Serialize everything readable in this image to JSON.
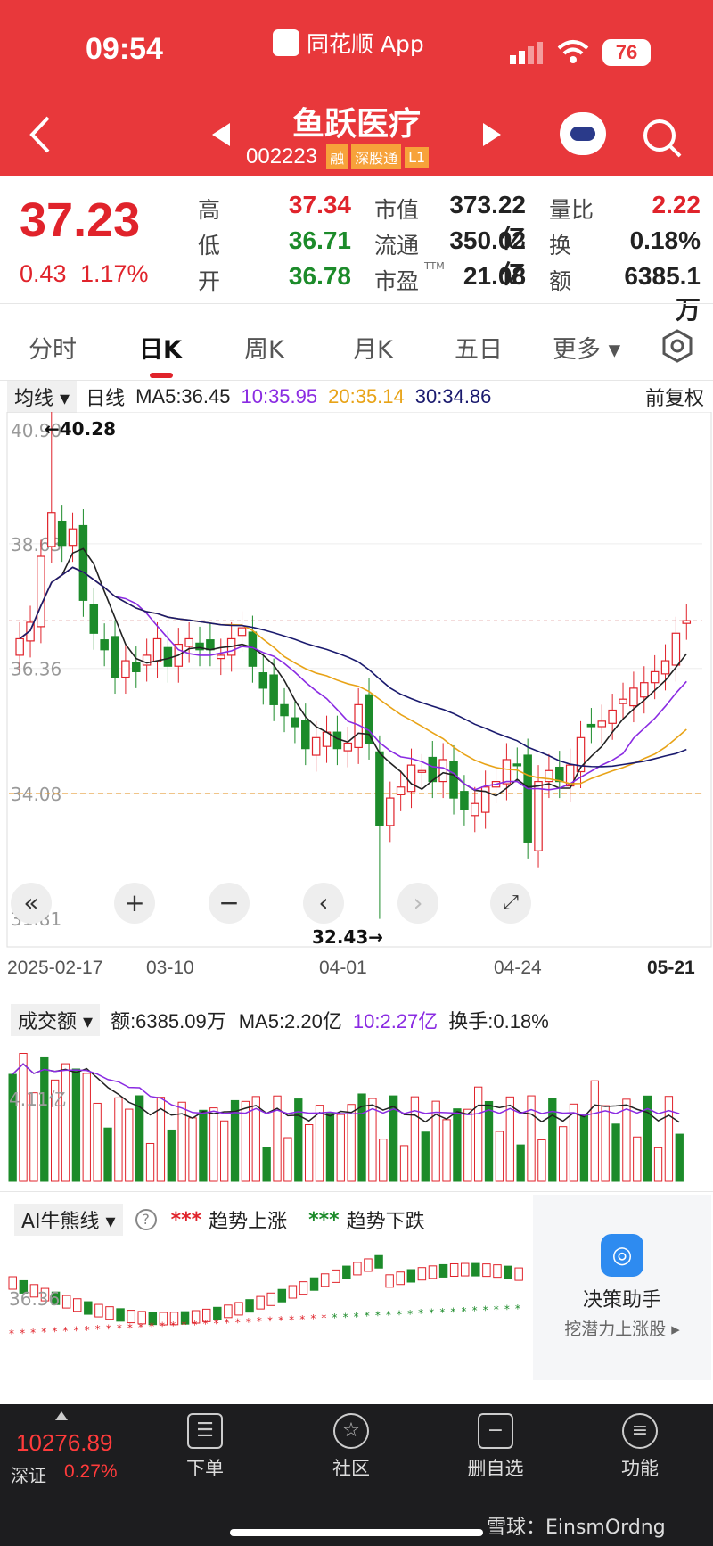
{
  "status_bar": {
    "time": "09:54",
    "app": "同花顺 App",
    "battery": "76"
  },
  "header": {
    "stock_name": "鱼跃医疗",
    "code": "002223",
    "badges": [
      "融",
      "深股通",
      "L1"
    ]
  },
  "quote": {
    "price": "37.23",
    "change": "0.43",
    "change_pct": "1.17%",
    "stats": [
      {
        "label": "高",
        "value": "37.34",
        "color": "red"
      },
      {
        "label": "市值",
        "value": "373.22亿",
        "color": "dark"
      },
      {
        "label": "量比",
        "value": "2.22",
        "color": "red"
      },
      {
        "label": "低",
        "value": "36.71",
        "color": "green"
      },
      {
        "label": "流通",
        "value": "350.02亿",
        "color": "dark"
      },
      {
        "label": "换",
        "value": "0.18%",
        "color": "dark"
      },
      {
        "label": "开",
        "value": "36.78",
        "color": "green"
      },
      {
        "label": "市盈",
        "value": "21.08",
        "color": "dark",
        "sup": "TTM"
      },
      {
        "label": "额",
        "value": "6385.1万",
        "color": "dark"
      }
    ]
  },
  "tabs": [
    "分时",
    "日K",
    "周K",
    "月K",
    "五日",
    "更多"
  ],
  "ma_bar": {
    "selector": "均线",
    "period": "日线",
    "ma5": "MA5:36.45",
    "ma10": "10:35.95",
    "ma20": "20:35.14",
    "ma30": "30:34.86",
    "adjust": "前复权"
  },
  "kline": {
    "y_labels": [
      "40.90",
      "38.63",
      "36.36",
      "34.08",
      "31.81"
    ],
    "max_label": "40.28",
    "min_label": "32.43",
    "dates": [
      "2025-02-17",
      "03-10",
      "04-01",
      "04-24",
      "05-21"
    ],
    "ref_price": 34.08,
    "current_price": 37.23
  },
  "volume": {
    "selector": "成交额",
    "amount": "额:6385.09万",
    "ma5": "MA5:2.20亿",
    "ma10": "10:2.27亿",
    "turnover": "换手:0.18%",
    "scale": "4.11亿"
  },
  "ai": {
    "selector": "AI牛熊线",
    "up": "趋势上涨",
    "down": "趋势下跌",
    "scale": "36.36",
    "helper_title": "决策助手",
    "helper_sub": "挖潜力上涨股"
  },
  "bottom": {
    "index_value": "10276.89",
    "index_name": "深证",
    "index_pct": "0.27%",
    "items": [
      "下单",
      "社区",
      "删自选",
      "功能"
    ],
    "watermark": "雪球：EinsmOrdng"
  },
  "colors": {
    "header": "#e8383b",
    "up": "#e0232b",
    "down": "#1c8b2a",
    "ma5": "#222222",
    "ma10": "#8a2be2",
    "ma20": "#e8a317",
    "ma30": "#1a1a6e"
  }
}
